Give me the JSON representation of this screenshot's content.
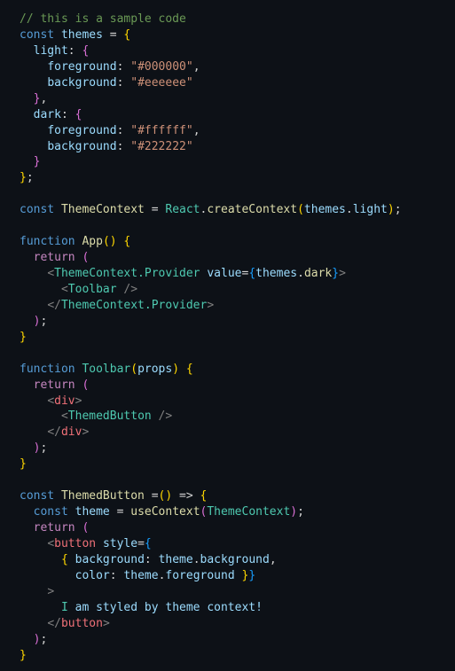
{
  "editor": {
    "theme_colors": {
      "background": "#0d1117",
      "comment": "#6a9955",
      "keyword": "#569cd6",
      "control": "#c586c0",
      "variable": "#9cdcfe",
      "string": "#ce9178",
      "function": "#dcdcaa",
      "component": "#4ec9b0",
      "html_tag": "#f07178",
      "bracket_level_1": "#ffd700",
      "bracket_level_2": "#da70d6",
      "bracket_level_3": "#179fff"
    },
    "lines": [
      [
        [
          "comment",
          "// this is a sample code"
        ]
      ],
      [
        [
          "keyword",
          "const"
        ],
        [
          "op",
          " "
        ],
        [
          "var",
          "themes"
        ],
        [
          "op",
          " = "
        ],
        [
          "b1",
          "{"
        ]
      ],
      [
        [
          "op",
          "  "
        ],
        [
          "prop",
          "light"
        ],
        [
          "punct",
          ": "
        ],
        [
          "b2",
          "{"
        ]
      ],
      [
        [
          "op",
          "    "
        ],
        [
          "prop",
          "foreground"
        ],
        [
          "punct",
          ": "
        ],
        [
          "string",
          "\"#000000\""
        ],
        [
          "punct",
          ","
        ]
      ],
      [
        [
          "op",
          "    "
        ],
        [
          "prop",
          "background"
        ],
        [
          "punct",
          ": "
        ],
        [
          "string",
          "\"#eeeeee\""
        ]
      ],
      [
        [
          "op",
          "  "
        ],
        [
          "b2",
          "}"
        ],
        [
          "punct",
          ","
        ]
      ],
      [
        [
          "op",
          "  "
        ],
        [
          "prop",
          "dark"
        ],
        [
          "punct",
          ": "
        ],
        [
          "b2",
          "{"
        ]
      ],
      [
        [
          "op",
          "    "
        ],
        [
          "prop",
          "foreground"
        ],
        [
          "punct",
          ": "
        ],
        [
          "string",
          "\"#ffffff\""
        ],
        [
          "punct",
          ","
        ]
      ],
      [
        [
          "op",
          "    "
        ],
        [
          "prop",
          "background"
        ],
        [
          "punct",
          ": "
        ],
        [
          "string",
          "\"#222222\""
        ]
      ],
      [
        [
          "op",
          "  "
        ],
        [
          "b2",
          "}"
        ]
      ],
      [
        [
          "b1",
          "}"
        ],
        [
          "punct",
          ";"
        ]
      ],
      [],
      [
        [
          "keyword",
          "const"
        ],
        [
          "op",
          " "
        ],
        [
          "func",
          "ThemeContext"
        ],
        [
          "op",
          " = "
        ],
        [
          "class",
          "React"
        ],
        [
          "punct",
          "."
        ],
        [
          "func",
          "createContext"
        ],
        [
          "b1",
          "("
        ],
        [
          "var",
          "themes"
        ],
        [
          "punct",
          "."
        ],
        [
          "var",
          "light"
        ],
        [
          "b1",
          ")"
        ],
        [
          "punct",
          ";"
        ]
      ],
      [],
      [
        [
          "keyword",
          "function"
        ],
        [
          "op",
          " "
        ],
        [
          "func",
          "App"
        ],
        [
          "b1",
          "()"
        ],
        [
          "op",
          " "
        ],
        [
          "b1",
          "{"
        ]
      ],
      [
        [
          "op",
          "  "
        ],
        [
          "control",
          "return"
        ],
        [
          "op",
          " "
        ],
        [
          "b2",
          "("
        ]
      ],
      [
        [
          "op",
          "    "
        ],
        [
          "angle",
          "<"
        ],
        [
          "tag",
          "ThemeContext.Provider"
        ],
        [
          "op",
          " "
        ],
        [
          "var",
          "value"
        ],
        [
          "op",
          "="
        ],
        [
          "b3",
          "{"
        ],
        [
          "var",
          "themes"
        ],
        [
          "punct",
          "."
        ],
        [
          "func",
          "dark"
        ],
        [
          "b3",
          "}"
        ],
        [
          "angle",
          ">"
        ]
      ],
      [
        [
          "op",
          "      "
        ],
        [
          "angle",
          "<"
        ],
        [
          "tag",
          "Toolbar"
        ],
        [
          "op",
          " "
        ],
        [
          "angle",
          "/>"
        ]
      ],
      [
        [
          "op",
          "    "
        ],
        [
          "angle",
          "</"
        ],
        [
          "tag",
          "ThemeContext.Provider"
        ],
        [
          "angle",
          ">"
        ]
      ],
      [
        [
          "op",
          "  "
        ],
        [
          "b2",
          ")"
        ],
        [
          "punct",
          ";"
        ]
      ],
      [
        [
          "b1",
          "}"
        ]
      ],
      [],
      [
        [
          "keyword",
          "function"
        ],
        [
          "op",
          " "
        ],
        [
          "class",
          "Toolbar"
        ],
        [
          "b1",
          "("
        ],
        [
          "var",
          "props"
        ],
        [
          "b1",
          ")"
        ],
        [
          "op",
          " "
        ],
        [
          "b1",
          "{"
        ]
      ],
      [
        [
          "op",
          "  "
        ],
        [
          "control",
          "return"
        ],
        [
          "op",
          " "
        ],
        [
          "b2",
          "("
        ]
      ],
      [
        [
          "op",
          "    "
        ],
        [
          "angle",
          "<"
        ],
        [
          "htmltag",
          "div"
        ],
        [
          "angle",
          ">"
        ]
      ],
      [
        [
          "op",
          "      "
        ],
        [
          "angle",
          "<"
        ],
        [
          "tag",
          "ThemedButton"
        ],
        [
          "op",
          " "
        ],
        [
          "angle",
          "/>"
        ]
      ],
      [
        [
          "op",
          "    "
        ],
        [
          "angle",
          "</"
        ],
        [
          "htmltag",
          "div"
        ],
        [
          "angle",
          ">"
        ]
      ],
      [
        [
          "op",
          "  "
        ],
        [
          "b2",
          ")"
        ],
        [
          "punct",
          ";"
        ]
      ],
      [
        [
          "b1",
          "}"
        ]
      ],
      [],
      [
        [
          "keyword",
          "const"
        ],
        [
          "op",
          " "
        ],
        [
          "func",
          "ThemedButton"
        ],
        [
          "op",
          " ="
        ],
        [
          "b1",
          "()"
        ],
        [
          "op",
          " => "
        ],
        [
          "b1",
          "{"
        ]
      ],
      [
        [
          "op",
          "  "
        ],
        [
          "keyword",
          "const"
        ],
        [
          "op",
          " "
        ],
        [
          "var",
          "theme"
        ],
        [
          "op",
          " = "
        ],
        [
          "func",
          "useContext"
        ],
        [
          "b2",
          "("
        ],
        [
          "class",
          "ThemeContext"
        ],
        [
          "b2",
          ")"
        ],
        [
          "punct",
          ";"
        ]
      ],
      [
        [
          "op",
          "  "
        ],
        [
          "control",
          "return"
        ],
        [
          "op",
          " "
        ],
        [
          "b2",
          "("
        ]
      ],
      [
        [
          "op",
          "    "
        ],
        [
          "angle",
          "<"
        ],
        [
          "htmltag",
          "button"
        ],
        [
          "op",
          " "
        ],
        [
          "var",
          "style"
        ],
        [
          "op",
          "="
        ],
        [
          "b3",
          "{"
        ]
      ],
      [
        [
          "op",
          "      "
        ],
        [
          "b1",
          "{"
        ],
        [
          "op",
          " "
        ],
        [
          "var",
          "background"
        ],
        [
          "punct",
          ": "
        ],
        [
          "var",
          "theme"
        ],
        [
          "punct",
          "."
        ],
        [
          "var",
          "background"
        ],
        [
          "punct",
          ","
        ]
      ],
      [
        [
          "op",
          "        "
        ],
        [
          "var",
          "color"
        ],
        [
          "punct",
          ": "
        ],
        [
          "var",
          "theme"
        ],
        [
          "punct",
          "."
        ],
        [
          "var",
          "foreground"
        ],
        [
          "op",
          " "
        ],
        [
          "b1",
          "}"
        ],
        [
          "b3",
          "}"
        ]
      ],
      [
        [
          "op",
          "    "
        ],
        [
          "angle",
          ">"
        ]
      ],
      [
        [
          "op",
          "      "
        ],
        [
          "text-first",
          "I"
        ],
        [
          "text",
          " am styled by theme context!"
        ]
      ],
      [
        [
          "op",
          "    "
        ],
        [
          "angle",
          "</"
        ],
        [
          "htmltag",
          "button"
        ],
        [
          "angle",
          ">"
        ]
      ],
      [
        [
          "op",
          "  "
        ],
        [
          "b2",
          ")"
        ],
        [
          "punct",
          ";"
        ]
      ],
      [
        [
          "b1",
          "}"
        ]
      ]
    ]
  }
}
